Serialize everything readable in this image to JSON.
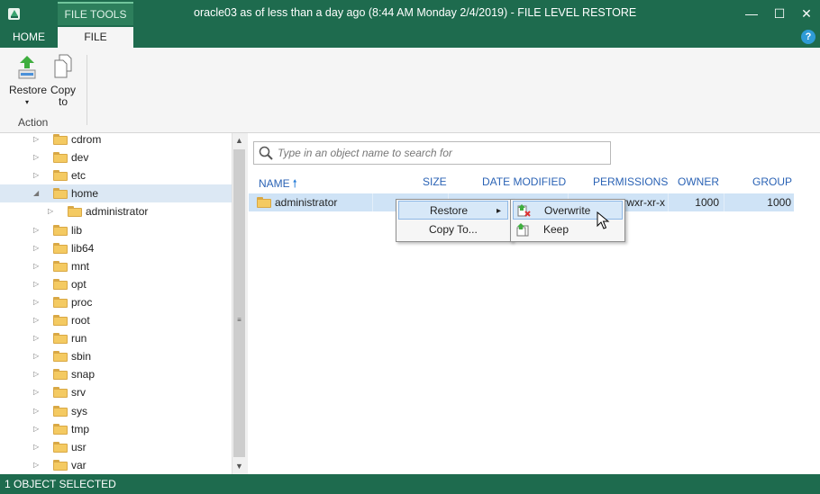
{
  "window": {
    "title": "oracle03 as of less than a day ago (8:44 AM Monday 2/4/2019) - FILE LEVEL RESTORE",
    "contextual_tab_group": "FILE TOOLS",
    "tabs": [
      "HOME",
      "FILE"
    ],
    "active_tab": "FILE",
    "controls": {
      "minimize": "—",
      "maximize": "☐",
      "close": "✕"
    },
    "help": "?"
  },
  "ribbon": {
    "restore_label": "Restore",
    "restore_arrow": "▾",
    "copy_label": "Copy",
    "copy_label2": "to",
    "group_label": "Action"
  },
  "tree": {
    "items": [
      {
        "label": "cdrom",
        "arrow": "▷"
      },
      {
        "label": "dev",
        "arrow": "▷"
      },
      {
        "label": "etc",
        "arrow": "▷"
      },
      {
        "label": "home",
        "arrow": "◢",
        "selected": true
      },
      {
        "label": "administrator",
        "arrow": "▷",
        "child": true
      },
      {
        "label": "lib",
        "arrow": "▷"
      },
      {
        "label": "lib64",
        "arrow": "▷"
      },
      {
        "label": "mnt",
        "arrow": "▷"
      },
      {
        "label": "opt",
        "arrow": "▷"
      },
      {
        "label": "proc",
        "arrow": "▷"
      },
      {
        "label": "root",
        "arrow": "▷"
      },
      {
        "label": "run",
        "arrow": "▷"
      },
      {
        "label": "sbin",
        "arrow": "▷"
      },
      {
        "label": "snap",
        "arrow": "▷"
      },
      {
        "label": "srv",
        "arrow": "▷"
      },
      {
        "label": "sys",
        "arrow": "▷"
      },
      {
        "label": "tmp",
        "arrow": "▷"
      },
      {
        "label": "usr",
        "arrow": "▷"
      },
      {
        "label": "var",
        "arrow": "▷"
      }
    ]
  },
  "search": {
    "placeholder": "Type in an object name to search for"
  },
  "table": {
    "columns": {
      "name": "NAME",
      "size": "SIZE",
      "date_modified": "DATE MODIFIED",
      "permissions": "PERMISSIONS",
      "owner": "OWNER",
      "group": "GROUP"
    },
    "sort_indicator": "🠕",
    "rows": [
      {
        "name": "administrator",
        "permissions": "rwxr-xr-x",
        "owner": "1000",
        "group": "1000"
      }
    ]
  },
  "context_menu": {
    "items": [
      "Restore",
      "Copy To..."
    ],
    "submenu_arrow": "▸",
    "submenu": [
      "Overwrite",
      "Keep"
    ]
  },
  "status": {
    "text": "1 OBJECT SELECTED"
  },
  "colors": {
    "chrome": "#1e6b4e",
    "selection": "#cfe3f6",
    "header_text": "#2b63b5"
  }
}
